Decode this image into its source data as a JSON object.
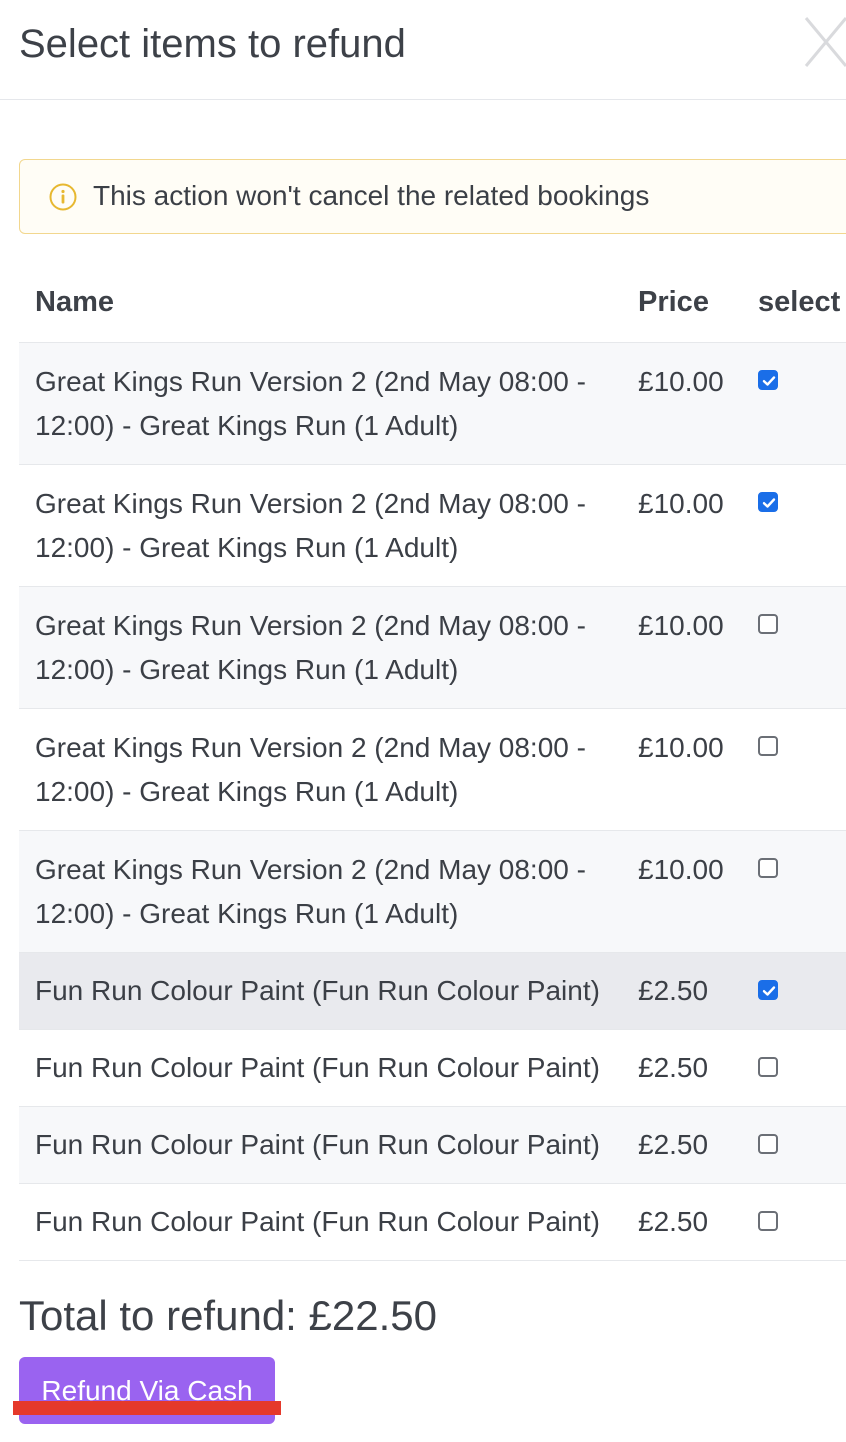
{
  "modal": {
    "title": "Select items to refund"
  },
  "alert": {
    "text": "This action won't cancel the related bookings",
    "icon": "info-icon",
    "color": "#e7b830"
  },
  "table": {
    "headers": {
      "name": "Name",
      "price": "Price",
      "select": "select"
    },
    "rows": [
      {
        "name": "Great Kings Run Version 2 (2nd May 08:00 - 12:00) - Great Kings Run (1 Adult)",
        "price": "£10.00",
        "selected": true
      },
      {
        "name": "Great Kings Run Version 2 (2nd May 08:00 - 12:00) - Great Kings Run (1 Adult)",
        "price": "£10.00",
        "selected": true
      },
      {
        "name": "Great Kings Run Version 2 (2nd May 08:00 - 12:00) - Great Kings Run (1 Adult)",
        "price": "£10.00",
        "selected": false
      },
      {
        "name": "Great Kings Run Version 2 (2nd May 08:00 - 12:00) - Great Kings Run (1 Adult)",
        "price": "£10.00",
        "selected": false
      },
      {
        "name": "Great Kings Run Version 2 (2nd May 08:00 - 12:00) - Great Kings Run (1 Adult)",
        "price": "£10.00",
        "selected": false
      },
      {
        "name": "Fun Run Colour Paint (Fun Run Colour Paint)",
        "price": "£2.50",
        "selected": true
      },
      {
        "name": "Fun Run Colour Paint (Fun Run Colour Paint)",
        "price": "£2.50",
        "selected": false
      },
      {
        "name": "Fun Run Colour Paint (Fun Run Colour Paint)",
        "price": "£2.50",
        "selected": false
      },
      {
        "name": "Fun Run Colour Paint (Fun Run Colour Paint)",
        "price": "£2.50",
        "selected": false
      }
    ]
  },
  "total": {
    "text": "Total to refund: £22.50"
  },
  "actions": {
    "refund_label": "Refund Via Cash",
    "refund_color": "#9a63f0"
  },
  "colors": {
    "accent": "#1a6ee8",
    "annotation": "#e5392b"
  }
}
